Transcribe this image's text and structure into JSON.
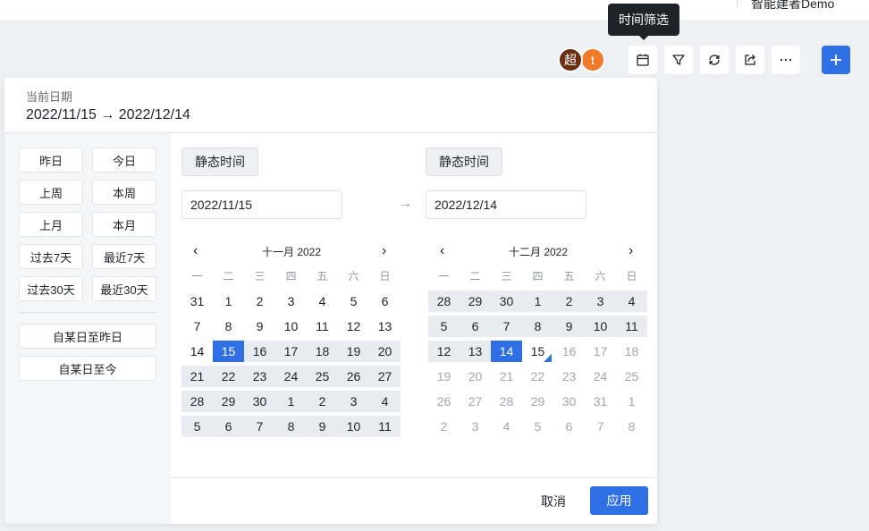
{
  "topbar": {
    "title": "智能建者Demo"
  },
  "collaborators": [
    {
      "initial": "超",
      "color": "#6b2d0f"
    },
    {
      "initial": "t",
      "color": "#f07a2a"
    }
  ],
  "toolbar": {
    "tooltip": "时间筛选",
    "icons": [
      "calendar-icon",
      "filter-icon",
      "refresh-icon",
      "share-icon",
      "more-icon",
      "plus-icon"
    ],
    "accent": "#2f6fe4"
  },
  "panel": {
    "current_label": "当前日期",
    "current_range": "2022/11/15 → 2022/12/14"
  },
  "quick": {
    "pairs": [
      [
        "昨日",
        "今日"
      ],
      [
        "上周",
        "本周"
      ],
      [
        "上月",
        "本月"
      ],
      [
        "过去7天",
        "最近7天"
      ],
      [
        "过去30天",
        "最近30天"
      ]
    ],
    "since_yesterday": "自某日至昨日",
    "since_today": "自某日至今"
  },
  "range": {
    "start_tag": "静态时间",
    "end_tag": "静态时间",
    "start_value": "2022/11/15",
    "end_value": "2022/12/14"
  },
  "calendars": {
    "weekdays": [
      "一",
      "二",
      "三",
      "四",
      "五",
      "六",
      "日"
    ],
    "prev": "‹",
    "next": "›",
    "left": {
      "title": "十一月 2022",
      "weeks": [
        [
          "31",
          "1",
          "2",
          "3",
          "4",
          "5",
          "6"
        ],
        [
          "7",
          "8",
          "9",
          "10",
          "11",
          "12",
          "13"
        ],
        [
          "14",
          "15",
          "16",
          "17",
          "18",
          "19",
          "20"
        ],
        [
          "21",
          "22",
          "23",
          "24",
          "25",
          "26",
          "27"
        ],
        [
          "28",
          "29",
          "30",
          "1",
          "2",
          "3",
          "4"
        ],
        [
          "5",
          "6",
          "7",
          "8",
          "9",
          "10",
          "11"
        ]
      ]
    },
    "right": {
      "title": "十二月 2022",
      "weeks": [
        [
          "28",
          "29",
          "30",
          "1",
          "2",
          "3",
          "4"
        ],
        [
          "5",
          "6",
          "7",
          "8",
          "9",
          "10",
          "11"
        ],
        [
          "12",
          "13",
          "14",
          "15",
          "16",
          "17",
          "18"
        ],
        [
          "19",
          "20",
          "21",
          "22",
          "23",
          "24",
          "25"
        ],
        [
          "26",
          "27",
          "28",
          "29",
          "30",
          "31",
          "1"
        ],
        [
          "2",
          "3",
          "4",
          "5",
          "6",
          "7",
          "8"
        ]
      ]
    }
  },
  "footer": {
    "cancel": "取消",
    "apply": "应用"
  }
}
